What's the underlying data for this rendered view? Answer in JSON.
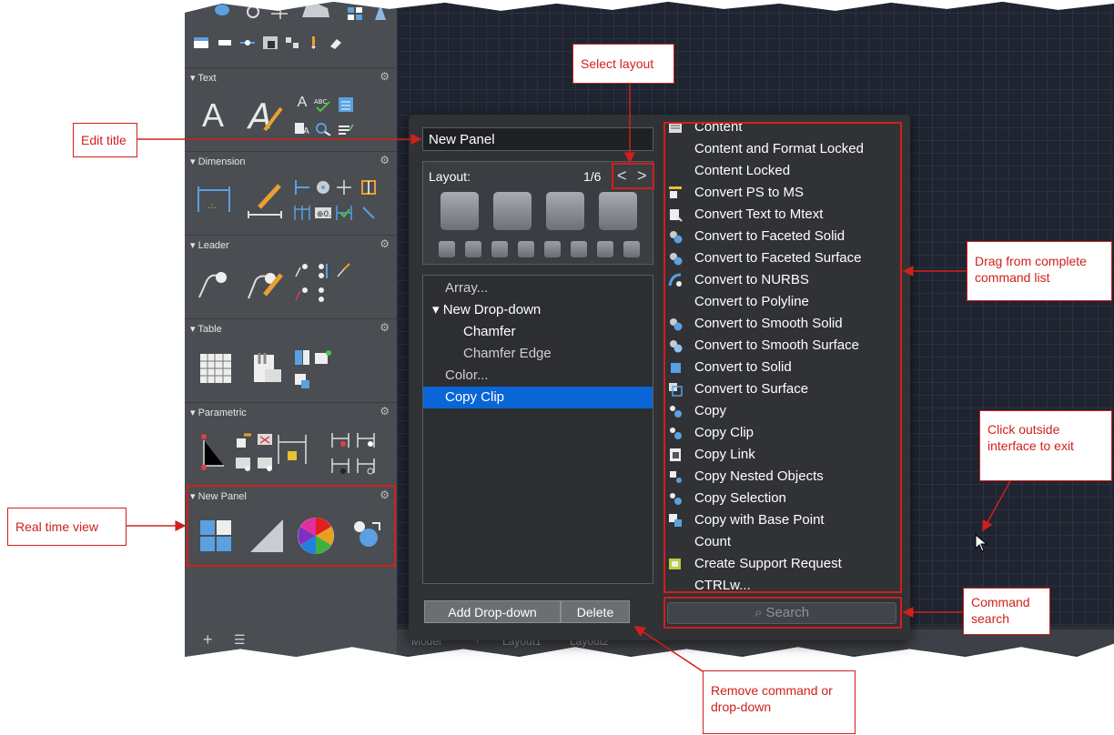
{
  "sidebar": {
    "groups": [
      {
        "label": "Text"
      },
      {
        "label": "Dimension"
      },
      {
        "label": "Leader"
      },
      {
        "label": "Table"
      },
      {
        "label": "Parametric"
      },
      {
        "label": "New Panel"
      }
    ],
    "add_symbol": "+",
    "menu_symbol": "☰"
  },
  "bottom_tabs": [
    "Model",
    "+",
    "Layout1",
    "Layout2"
  ],
  "popup": {
    "title_value": "New Panel",
    "layout_label": "Layout:",
    "layout_page": "1/6",
    "prev_symbol": "<",
    "next_symbol": ">",
    "tree": [
      {
        "label": "Array...",
        "level": 0
      },
      {
        "label": "▾ New Drop-down",
        "level": 0
      },
      {
        "label": "Chamfer",
        "level": 1
      },
      {
        "label": "Chamfer Edge",
        "level": 1
      },
      {
        "label": "Color...",
        "level": 0
      },
      {
        "label": "Copy Clip",
        "level": 0,
        "selected": true
      }
    ],
    "add_dropdown_label": "Add Drop-down",
    "delete_label": "Delete",
    "commands": [
      {
        "label": "Content",
        "icon": "content-icon"
      },
      {
        "label": "Content and Format Locked",
        "icon": ""
      },
      {
        "label": "Content Locked",
        "icon": ""
      },
      {
        "label": "Convert PS to MS",
        "icon": "convert-ps-ms-icon"
      },
      {
        "label": "Convert Text to Mtext",
        "icon": "convert-text-icon"
      },
      {
        "label": "Convert to Faceted Solid",
        "icon": "faceted-solid-icon"
      },
      {
        "label": "Convert to Faceted Surface",
        "icon": "faceted-surface-icon"
      },
      {
        "label": "Convert to NURBS",
        "icon": "nurbs-icon"
      },
      {
        "label": "Convert to Polyline",
        "icon": ""
      },
      {
        "label": "Convert to Smooth Solid",
        "icon": "smooth-solid-icon"
      },
      {
        "label": "Convert to Smooth Surface",
        "icon": "smooth-surface-icon"
      },
      {
        "label": "Convert to Solid",
        "icon": "solid-icon"
      },
      {
        "label": "Convert to Surface",
        "icon": "surface-icon"
      },
      {
        "label": "Copy",
        "icon": "copy-icon"
      },
      {
        "label": "Copy Clip",
        "icon": "copy-clip-icon"
      },
      {
        "label": "Copy Link",
        "icon": "copy-link-icon"
      },
      {
        "label": "Copy Nested Objects",
        "icon": "copy-nested-icon"
      },
      {
        "label": "Copy Selection",
        "icon": "copy-selection-icon"
      },
      {
        "label": "Copy with Base Point",
        "icon": "copy-base-point-icon"
      },
      {
        "label": "Count",
        "icon": ""
      },
      {
        "label": "Create Support Request",
        "icon": "support-request-icon"
      },
      {
        "label": "CTRLw...",
        "icon": ""
      }
    ],
    "search_placeholder": "Search",
    "search_icon": "search-icon"
  },
  "callouts": {
    "select_layout": "Select layout",
    "edit_title": "Edit title",
    "drag_from": "Drag from complete command list",
    "click_outside": "Click outside interface to exit",
    "real_time": "Real time view",
    "command_search": "Command search",
    "remove": "Remove command or drop-down"
  },
  "colors": {
    "annotation_red": "#d0201a",
    "selected_row": "#0a66d6",
    "popup_bg": "#303236"
  }
}
